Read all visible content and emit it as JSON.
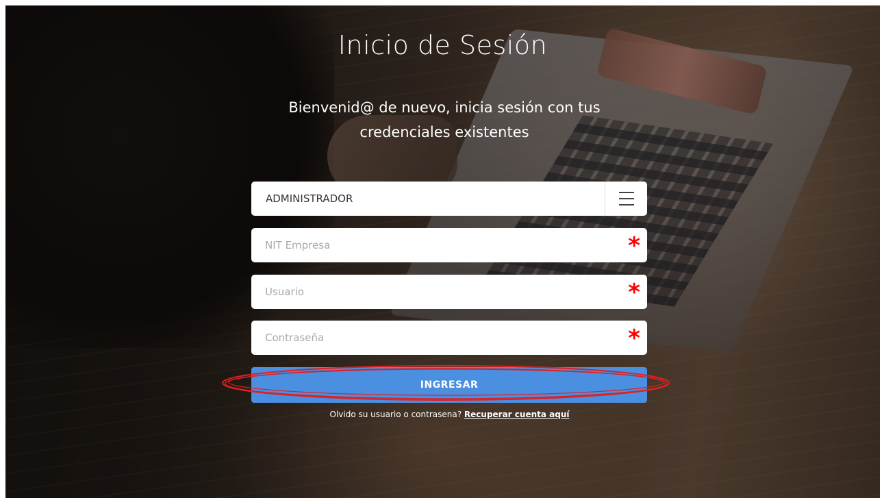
{
  "login": {
    "title": "Inicio de Sesión",
    "subtitle": "Bienvenid@ de nuevo, inicia sesión con tus credenciales existentes",
    "role_select": {
      "selected_value": "ADMINISTRADOR",
      "icon": "hamburger-menu-icon"
    },
    "fields": {
      "nit": {
        "placeholder": "NIT Empresa",
        "value": "",
        "required_mark": "*"
      },
      "usuario": {
        "placeholder": "Usuario",
        "value": "",
        "required_mark": "*"
      },
      "contrasena": {
        "placeholder": "Contraseña",
        "value": "",
        "required_mark": "*"
      }
    },
    "submit_label": "INGRESAR",
    "recover_text": "Olvido su usuario o contrasena?",
    "recover_link": "Recuperar cuenta aquí"
  },
  "colors": {
    "button": "#4a8fe0",
    "required": "#ff0000",
    "highlight_ring": "#e02020"
  }
}
